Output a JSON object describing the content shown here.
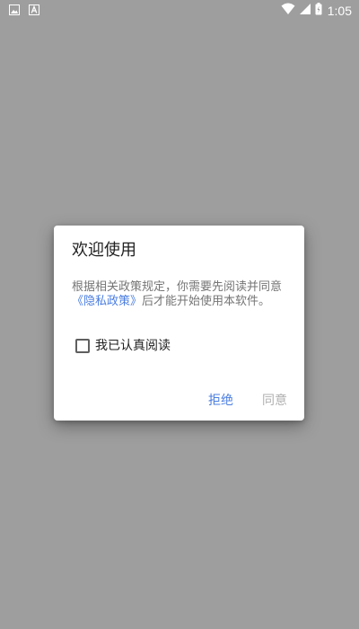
{
  "status_bar": {
    "time": "1:05",
    "icons": [
      "image-notification-icon",
      "a-notification-icon",
      "wifi-icon",
      "cellular-signal-icon",
      "battery-icon"
    ]
  },
  "dialog": {
    "title": "欢迎使用",
    "message_before_link": "根据相关政策规定，你需要先阅读并同意",
    "privacy_link": "《隐私政策》",
    "message_after_link": "后才能开始使用本软件。",
    "checkbox_label": "我已认真阅读",
    "checkbox_checked": false,
    "reject_label": "拒绝",
    "agree_label": "同意"
  },
  "colors": {
    "overlay_background": "#9e9e9e",
    "link": "#4a7de0",
    "disabled_button": "#b0b0b0"
  }
}
